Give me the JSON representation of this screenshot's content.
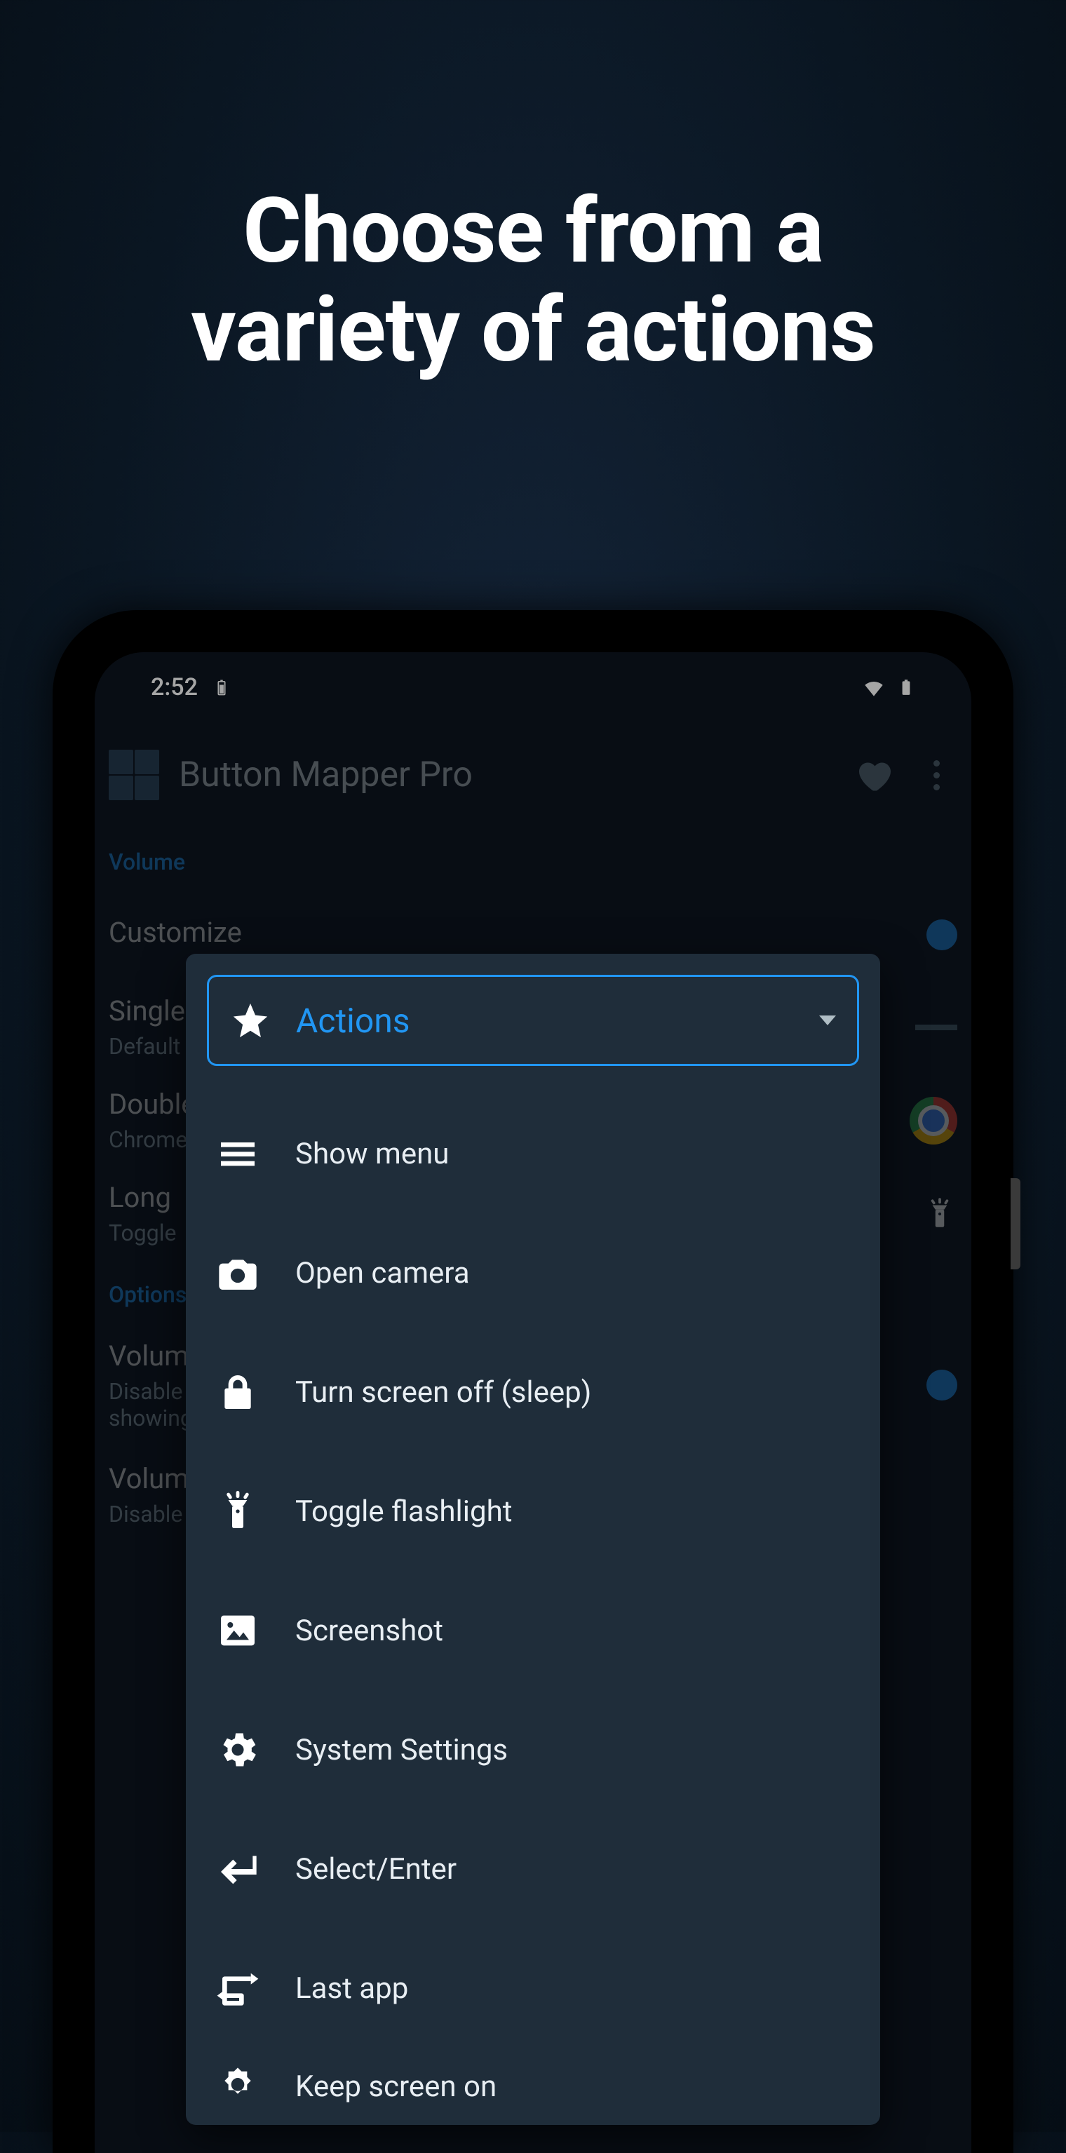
{
  "promo": {
    "headline_l1": "Choose from a",
    "headline_l2": "variety of actions"
  },
  "status": {
    "time": "2:52"
  },
  "appbar": {
    "title": "Button Mapper Pro"
  },
  "bg": {
    "section_volume": "Volume",
    "customize": "Customize",
    "single_title": "Single",
    "single_sub": "Default",
    "double_title": "Double",
    "double_sub": "Chrome",
    "long_title": "Long",
    "long_sub": "Toggle",
    "section_options": "Options",
    "vol_title_a": "Volume",
    "vol_sub_a1": "Disable",
    "vol_sub_a2": "showing",
    "vol_title_b": "Volume",
    "vol_sub_b": "Disable"
  },
  "dropdown": {
    "header": "Actions",
    "items": [
      {
        "label": "Show menu",
        "icon": "menu"
      },
      {
        "label": "Open camera",
        "icon": "camera"
      },
      {
        "label": "Turn screen off (sleep)",
        "icon": "lock"
      },
      {
        "label": "Toggle flashlight",
        "icon": "flashlight"
      },
      {
        "label": "Screenshot",
        "icon": "image"
      },
      {
        "label": "System Settings",
        "icon": "settings"
      },
      {
        "label": "Select/Enter",
        "icon": "enter"
      },
      {
        "label": "Last app",
        "icon": "lastapp"
      },
      {
        "label": "Keep screen on",
        "icon": "brightness"
      }
    ]
  }
}
